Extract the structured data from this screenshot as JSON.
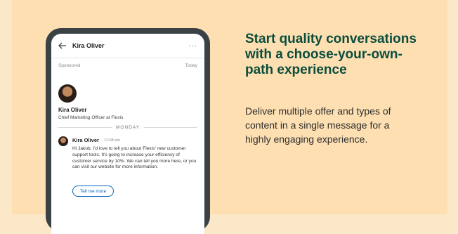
{
  "phone": {
    "header": {
      "contact_name": "Kira Oliver",
      "more_glyph": "···"
    },
    "meta": {
      "sponsored": "Sponsored",
      "date": "Today"
    },
    "profile": {
      "name": "Kira Oliver",
      "title": "Chief Marketing Officer at Flexis"
    },
    "divider": "MONDAY",
    "message": {
      "sender": "Kira Oliver",
      "time": "· 11:08 am",
      "body": "Hi Jakob, I'd love to tell you about Flexis' new customer support tools. It's going to increase your efficiency of customer service by 10%. We can tell you more here, or you can visit our website for more information.",
      "cta_label": "Tell me more"
    },
    "icons": {
      "back": "back-arrow-icon",
      "more": "more-options-icon"
    }
  },
  "feature": {
    "headline": "Start quality conversations with a choose-your-own-path experience",
    "description": "Deliver multiple offer and types of content in a single message for a highly engaging experience."
  },
  "colors": {
    "background": "#fddfb2",
    "headline": "#0b4d3c",
    "phone_frame": "#3b4246",
    "link": "#0a66c2"
  }
}
